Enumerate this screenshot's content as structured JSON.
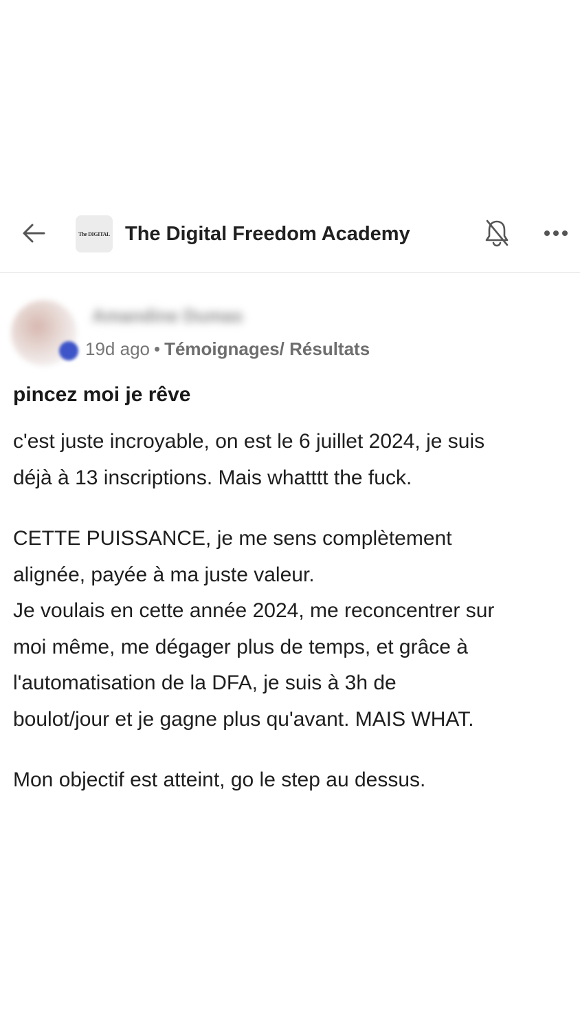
{
  "header": {
    "group_name": "The Digital Freedom Academy",
    "logo_text": "The DIGITAL",
    "back_icon": "arrow-left-icon",
    "bell_icon": "bell-off-icon",
    "more_icon": "more-horizontal-icon"
  },
  "post": {
    "author_name": "Amandine Dumas",
    "time_ago": "19d ago",
    "separator": "•",
    "category": "Témoignages/ Résultats",
    "title": "pincez moi je rêve",
    "paragraphs": [
      "c'est juste incroyable, on est le 6 juillet 2024, je suis\ndéjà à 13 inscriptions. Mais whatttt the fuck.",
      "CETTE PUISSANCE, je me sens complètement\nalignée, payée à ma juste valeur.\nJe voulais en cette année 2024, me reconcentrer sur\nmoi même, me dégager plus de temps, et grâce à\nl'automatisation de la DFA, je suis à 3h de\nboulot/jour et je gagne plus qu'avant. MAIS WHAT.",
      "Mon objectif est atteint, go le step au dessus."
    ]
  },
  "colors": {
    "text": "#1e1e1e",
    "meta": "#767676",
    "divider": "#e3e3e3",
    "avatar_badge": "#3d55c8"
  }
}
